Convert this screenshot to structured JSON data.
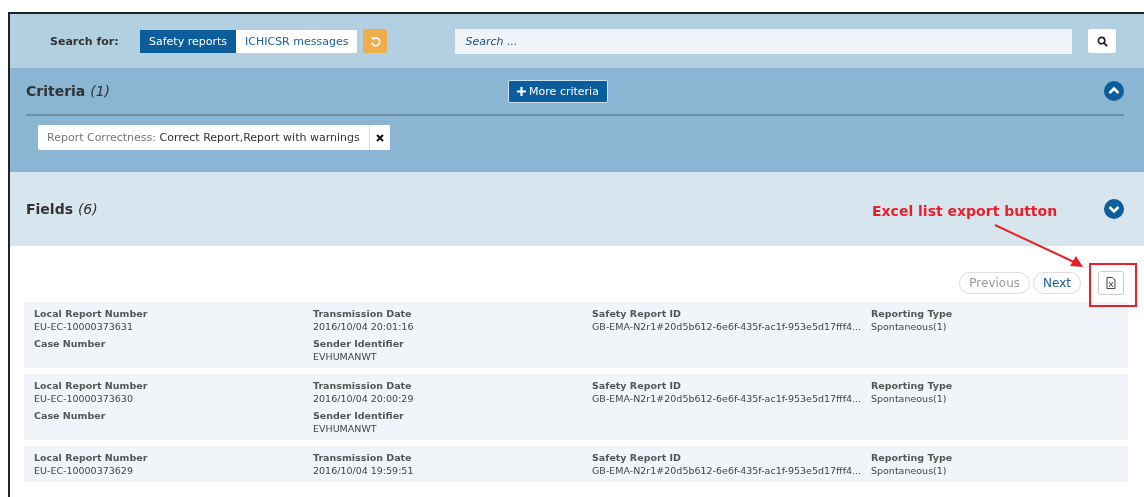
{
  "search": {
    "label": "Search for:",
    "tabs": [
      {
        "label": "Safety reports",
        "selected": true
      },
      {
        "label": "ICHICSR messages",
        "selected": false
      }
    ],
    "placeholder": "Search ..."
  },
  "criteria": {
    "title": "Criteria",
    "count": "(1)",
    "more_button": "More criteria",
    "expanded": true,
    "filters": [
      {
        "name": "Report Correctness:",
        "value": "Correct Report,Report with warnings"
      }
    ]
  },
  "fields": {
    "title": "Fields",
    "count": "(6)",
    "expanded": false
  },
  "pagination": {
    "previous": "Previous",
    "next": "Next"
  },
  "annotation": {
    "text": "Excel list export button"
  },
  "records": [
    {
      "fields": [
        {
          "label": "Local Report Number",
          "value": "EU-EC-10000373631"
        },
        {
          "label": "Transmission Date",
          "value": "2016/10/04 20:01:16"
        },
        {
          "label": "Safety Report ID",
          "value": "GB-EMA-N2r1#20d5b612-6e6f-435f-ac1f-953e5d17fff4..."
        },
        {
          "label": "Reporting Type",
          "value": "Spontaneous(1)"
        },
        {
          "label": "Case Number"
        },
        {
          "label": "Sender Identifier",
          "value": "EVHUMANWT"
        }
      ]
    },
    {
      "fields": [
        {
          "label": "Local Report Number",
          "value": "EU-EC-10000373630"
        },
        {
          "label": "Transmission Date",
          "value": "2016/10/04 20:00:29"
        },
        {
          "label": "Safety Report ID",
          "value": "GB-EMA-N2r1#20d5b612-6e6f-435f-ac1f-953e5d17fff4..."
        },
        {
          "label": "Reporting Type",
          "value": "Spontaneous(1)"
        },
        {
          "label": "Case Number"
        },
        {
          "label": "Sender Identifier",
          "value": "EVHUMANWT"
        }
      ]
    },
    {
      "fields": [
        {
          "label": "Local Report Number",
          "value": "EU-EC-10000373629"
        },
        {
          "label": "Transmission Date",
          "value": "2016/10/04 19:59:51"
        },
        {
          "label": "Safety Report ID",
          "value": "GB-EMA-N2r1#20d5b612-6e6f-435f-ac1f-953e5d17fff4..."
        },
        {
          "label": "Reporting Type",
          "value": "Spontaneous(1)"
        }
      ]
    }
  ]
}
